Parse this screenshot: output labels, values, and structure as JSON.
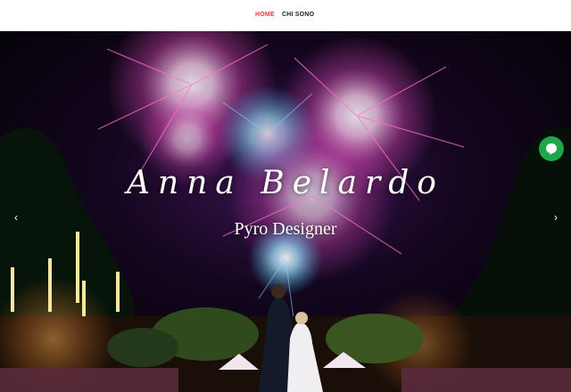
{
  "nav": {
    "items": [
      {
        "label": "HOME",
        "active": true
      },
      {
        "label": "CHI SONO",
        "active": false
      }
    ],
    "active_color": "#e53935"
  },
  "hero": {
    "title": "Anna Belardo",
    "subtitle": "Pyro Designer",
    "prev_icon": "chevron-left-icon",
    "next_icon": "chevron-right-icon",
    "prev_glyph": "‹",
    "next_glyph": "›"
  },
  "chat": {
    "icon": "chat-bubble-icon",
    "color": "#1fa64a"
  }
}
